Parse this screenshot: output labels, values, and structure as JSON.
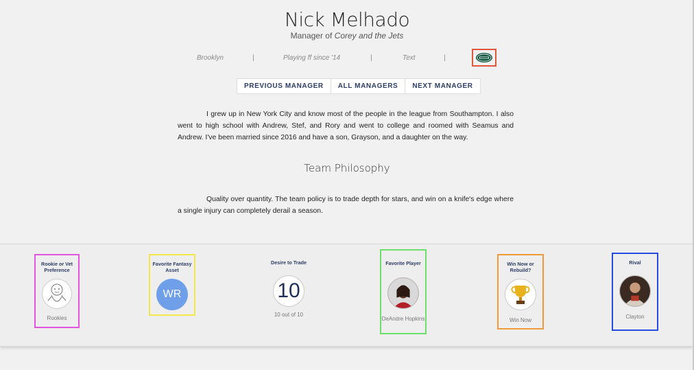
{
  "header": {
    "name": "Nick Melhado",
    "subtitle_prefix": "Manager of ",
    "team": "Corey and the Jets"
  },
  "info": {
    "location": "Brooklyn",
    "playing_since": "Playing ff since '14",
    "extra": "Text",
    "sep": "|"
  },
  "nav": {
    "prev": "PREVIOUS MANAGER",
    "all": "ALL MANAGERS",
    "next": "NEXT MANAGER"
  },
  "bio": "I grew up in New York City and know most of the people in the league from Southampton. I also went to high school with Andrew, Stef, and Rory and went to college and roomed with Seamus and Andrew. I've been married since 2016 and have a son, Grayson, and a daughter on the way.",
  "philosophy": {
    "heading": "Team Philosophy",
    "text": "Quality over quantity. The team policy is to trade depth for stars, and win on a knife's edge where a single injury can completely derail a season."
  },
  "cards": {
    "rookie": {
      "label": "Rookie or Vet Preference",
      "value": "Rookies",
      "border": "#e256e2"
    },
    "asset": {
      "label": "Favorite Fantasy Asset",
      "value": "WR",
      "border": "#f2e84a",
      "circle": "#6f9fe8"
    },
    "trade": {
      "label": "Desire to Trade",
      "number": "10",
      "value": "10 out of 10"
    },
    "player": {
      "label": "Favorite Player",
      "value": "DeAndre Hopkins",
      "border": "#6be06b"
    },
    "winnow": {
      "label": "Win Now or Rebuild?",
      "value": "Win Now",
      "border": "#f09a3c"
    },
    "rival": {
      "label": "Rival",
      "value": "Clayton",
      "border": "#2749e0"
    }
  },
  "colors": {
    "accent": "#2c3e66",
    "jets_green": "#125740"
  }
}
